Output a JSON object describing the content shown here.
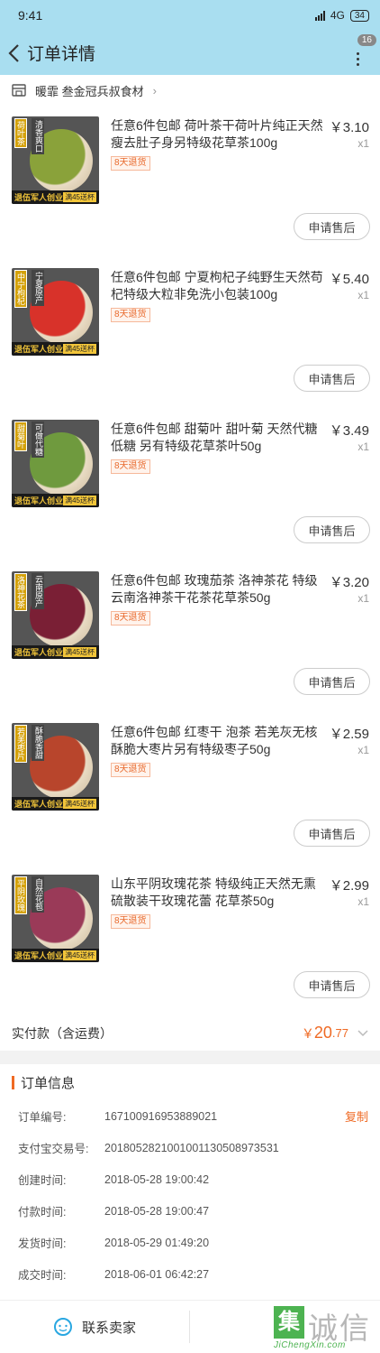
{
  "status_bar": {
    "time": "9:41",
    "network": "4G",
    "battery": "34"
  },
  "header": {
    "title": "订单详情",
    "badge": "16"
  },
  "shop": {
    "name": "暖霏 叁金冠兵叔食材"
  },
  "items": [
    {
      "title": "任意6件包邮 荷叶茶干荷叶片纯正天然瘦去肚子身另特级花草茶100g",
      "price": "￥3.10",
      "qty": "x1",
      "tag": "8天退货",
      "after_sale": "申请售后",
      "img_side": "荷叶茶",
      "img_top": "清香爽口",
      "img_band": "退伍军人创业",
      "img_badge": "满45送杯",
      "img_color": "#8aa23a"
    },
    {
      "title": "任意6件包邮 宁夏枸杞子纯野生天然苟杞特级大粒非免洗小包装100g",
      "price": "￥5.40",
      "qty": "x1",
      "tag": "8天退货",
      "after_sale": "申请售后",
      "img_side": "中宁枸杞",
      "img_top": "宁夏原产",
      "img_band": "退伍军人创业",
      "img_badge": "满45送杯",
      "img_color": "#d8322a"
    },
    {
      "title": "任意6件包邮 甜菊叶 甜叶菊 天然代糖低糖 另有特级花草茶叶50g",
      "price": "￥3.49",
      "qty": "x1",
      "tag": "8天退货",
      "after_sale": "申请售后",
      "img_side": "甜菊叶",
      "img_top": "可做代糖",
      "img_band": "退伍军人创业",
      "img_badge": "满45送杯",
      "img_color": "#6f9a3e"
    },
    {
      "title": "任意6件包邮 玫瑰茄茶 洛神茶花 特级云南洛神茶干花茶花草茶50g",
      "price": "￥3.20",
      "qty": "x1",
      "tag": "8天退货",
      "after_sale": "申请售后",
      "img_side": "洛神花茶",
      "img_top": "云南原产",
      "img_band": "退伍军人创业",
      "img_badge": "满45送杯",
      "img_color": "#7a1f35"
    },
    {
      "title": "任意6件包邮 红枣干 泡茶 若羌灰无核酥脆大枣片另有特级枣子50g",
      "price": "￥2.59",
      "qty": "x1",
      "tag": "8天退货",
      "after_sale": "申请售后",
      "img_side": "若羌枣片",
      "img_top": "酥脆香甜",
      "img_band": "退伍军人创业",
      "img_badge": "满45送杯",
      "img_color": "#b8452c"
    },
    {
      "title": "山东平阴玫瑰花茶 特级纯正天然无熏硫散装干玫瑰花蕾 花草茶50g",
      "price": "￥2.99",
      "qty": "x1",
      "tag": "8天退货",
      "after_sale": "申请售后",
      "img_side": "平阴玫瑰",
      "img_top": "自然花苞",
      "img_band": "退伍军人创业",
      "img_badge": "满45送杯",
      "img_color": "#9a3a58"
    }
  ],
  "total": {
    "label": "实付款（含运费）",
    "currency": "￥",
    "integer": "20",
    "decimal": ".77"
  },
  "order_info": {
    "heading": "订单信息",
    "copy_label": "复制",
    "rows": [
      {
        "key": "订单编号:",
        "value": "167100916953889021"
      },
      {
        "key": "支付宝交易号:",
        "value": "2018052821001001130508973531"
      },
      {
        "key": "创建时间:",
        "value": "2018-05-28 19:00:42"
      },
      {
        "key": "付款时间:",
        "value": "2018-05-28 19:00:47"
      },
      {
        "key": "发货时间:",
        "value": "2018-05-29 01:49:20"
      },
      {
        "key": "成交时间:",
        "value": "2018-06-01 06:42:27"
      }
    ]
  },
  "bottom": {
    "contact_label": "联系卖家"
  },
  "watermark": {
    "mark": "集",
    "text": "诚信",
    "domain": "JiChengXin.com"
  },
  "colors": {
    "accent": "#ef6a24",
    "header_bg": "#a9def0",
    "watermark_green": "#4db351"
  }
}
